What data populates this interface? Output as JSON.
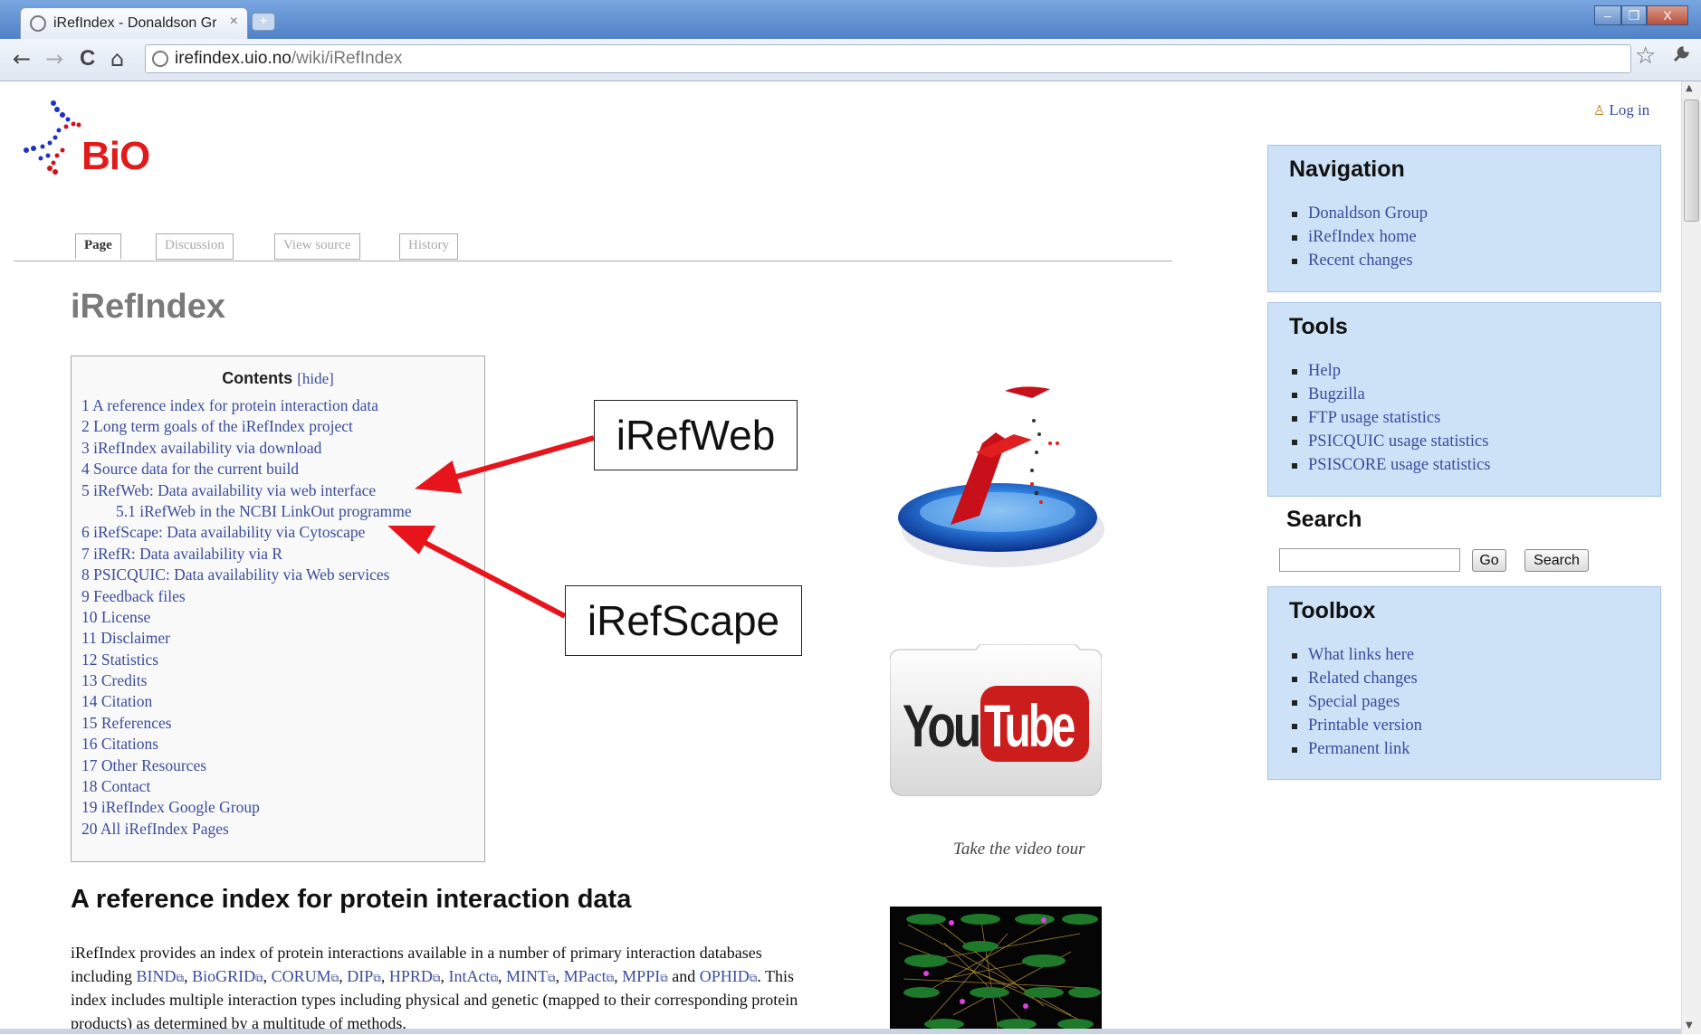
{
  "browser": {
    "tab_title": "iRefIndex - Donaldson Grou",
    "tab_close": "×",
    "new_tab": "+",
    "back": "←",
    "forward": "→",
    "reload": "C",
    "home": "⌂",
    "url_domain": "irefindex.uio.no",
    "url_path": "/wiki/iRefIndex",
    "bookmark_star": "☆",
    "wrench": "🔧",
    "minimize": "–",
    "restore": "❐",
    "close": "X"
  },
  "logo": {
    "text": "BiO"
  },
  "user": {
    "login": "Log in"
  },
  "page_tabs": [
    "Page",
    "Discussion",
    "View source",
    "History"
  ],
  "page_title": "iRefIndex",
  "toc": {
    "heading": "Contents",
    "hide": "[hide]",
    "items": [
      "1 A reference index for protein interaction data",
      "2 Long term goals of the iRefIndex project",
      "3 iRefIndex availability via download",
      "4 Source data for the current build",
      "5 iRefWeb: Data availability via web interface",
      "5.1 iRefWeb in the NCBI LinkOut programme",
      "6 iRefScape: Data availability via Cytoscape",
      "7 iRefR: Data availability via R",
      "8 PSICQUIC: Data availability via Web services",
      "9 Feedback files",
      "10 License",
      "11 Disclaimer",
      "12 Statistics",
      "13 Credits",
      "14 Citation",
      "15 References",
      "16 Citations",
      "17 Other Resources",
      "18 Contact",
      "19 iRefIndex Google Group",
      "20 All iRefIndex Pages"
    ]
  },
  "callouts": {
    "irefweb": "iRefWeb",
    "irefscape": "iRefScape"
  },
  "media": {
    "youtube_you": "You",
    "youtube_tube": "Tube",
    "video_caption": "Take the video tour"
  },
  "section": {
    "title": "A reference index for protein interaction data",
    "p1": "iRefIndex provides an index of protein interactions available in a number of primary interaction databases including ",
    "links": [
      "BIND",
      "BioGRID",
      "CORUM",
      "DIP",
      "HPRD",
      "IntAct",
      "MINT",
      "MPact",
      "MPPI",
      "OPHID"
    ],
    "and": " and ",
    "p2": ". This index includes multiple interaction types including physical and genetic (mapped to their corresponding protein products) as determined by a multitude of methods."
  },
  "sidebar": {
    "navigation": {
      "title": "Navigation",
      "items": [
        "Donaldson Group",
        "iRefIndex home",
        "Recent changes"
      ]
    },
    "tools": {
      "title": "Tools",
      "items": [
        "Help",
        "Bugzilla",
        "FTP usage statistics",
        "PSICQUIC usage statistics",
        "PSISCORE usage statistics"
      ]
    },
    "search": {
      "title": "Search",
      "go": "Go",
      "search": "Search",
      "value": ""
    },
    "toolbox": {
      "title": "Toolbox",
      "items": [
        "What links here",
        "Related changes",
        "Special pages",
        "Printable version",
        "Permanent link"
      ]
    }
  },
  "colors": {
    "link": "#3a4c9c",
    "portlet_bg": "#cde1f7",
    "arrow": "#e8141c",
    "logo": "#e01b1b"
  }
}
